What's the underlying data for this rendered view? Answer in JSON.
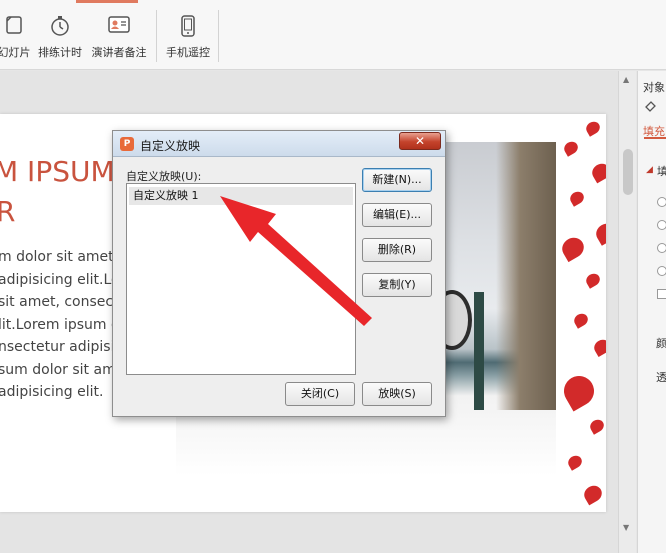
{
  "ribbon": {
    "buttons": [
      {
        "label": "幻灯片",
        "icon": "slides-icon"
      },
      {
        "label": "排练计时",
        "icon": "stopwatch-icon"
      },
      {
        "label": "演讲者备注",
        "icon": "speaker-notes-icon"
      },
      {
        "label": "手机遥控",
        "icon": "phone-remote-icon"
      }
    ]
  },
  "slide": {
    "title_line1": "M IPSUM",
    "title_line2": "R",
    "body_lines": [
      "m dolor sit amet,",
      "adipisicing elit.Lo",
      "sit amet, consect",
      "lit.Lorem ipsum d",
      "nsectetur adipisic",
      "sum dolor sit am",
      "adipisicing elit."
    ]
  },
  "right_pane": {
    "header": "对象",
    "tab_active": "填充",
    "section": "填",
    "label_color": "颜",
    "label_trans": "透"
  },
  "dialog": {
    "icon_text": "P",
    "title": "自定义放映",
    "close_glyph": "✕",
    "list_label": "自定义放映(U):",
    "list_items": [
      "自定义放映 1"
    ],
    "buttons": {
      "new": "新建(N)...",
      "edit": "编辑(E)...",
      "delete": "删除(R)",
      "copy": "复制(Y)",
      "close": "关闭(C)",
      "show": "放映(S)"
    }
  },
  "colors": {
    "accent": "#d35a3f",
    "arrow": "#e8262a",
    "slide_title": "#c9533e"
  }
}
